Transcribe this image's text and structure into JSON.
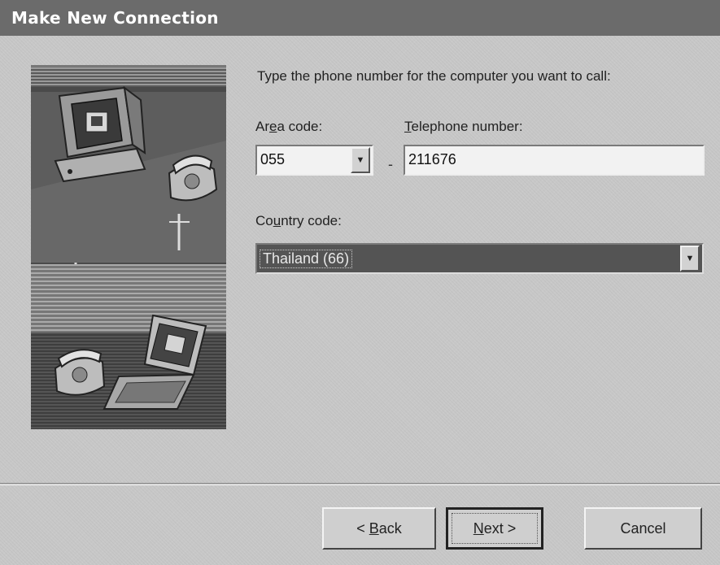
{
  "window": {
    "title": "Make New Connection"
  },
  "instruction": "Type the phone number for the computer you want to call:",
  "area_code": {
    "label_prefix": "Ar",
    "label_mnemonic": "e",
    "label_suffix": "a code:",
    "value": "055"
  },
  "separator_dash": "-",
  "telephone": {
    "label_mnemonic": "T",
    "label_suffix": "elephone number:",
    "value": "211676"
  },
  "country_code": {
    "label_prefix": "Co",
    "label_mnemonic": "u",
    "label_suffix": "ntry code:",
    "value": "Thailand (66)"
  },
  "buttons": {
    "back_prefix": "< ",
    "back_mnemonic": "B",
    "back_suffix": "ack",
    "next_mnemonic": "N",
    "next_suffix": "ext >",
    "cancel": "Cancel"
  },
  "icons": {
    "dropdown": "chevron-down-icon"
  },
  "colors": {
    "title_bar": "#6b6b6b",
    "dialog_bg": "#c8c8c8",
    "selected_bg": "#545454"
  }
}
